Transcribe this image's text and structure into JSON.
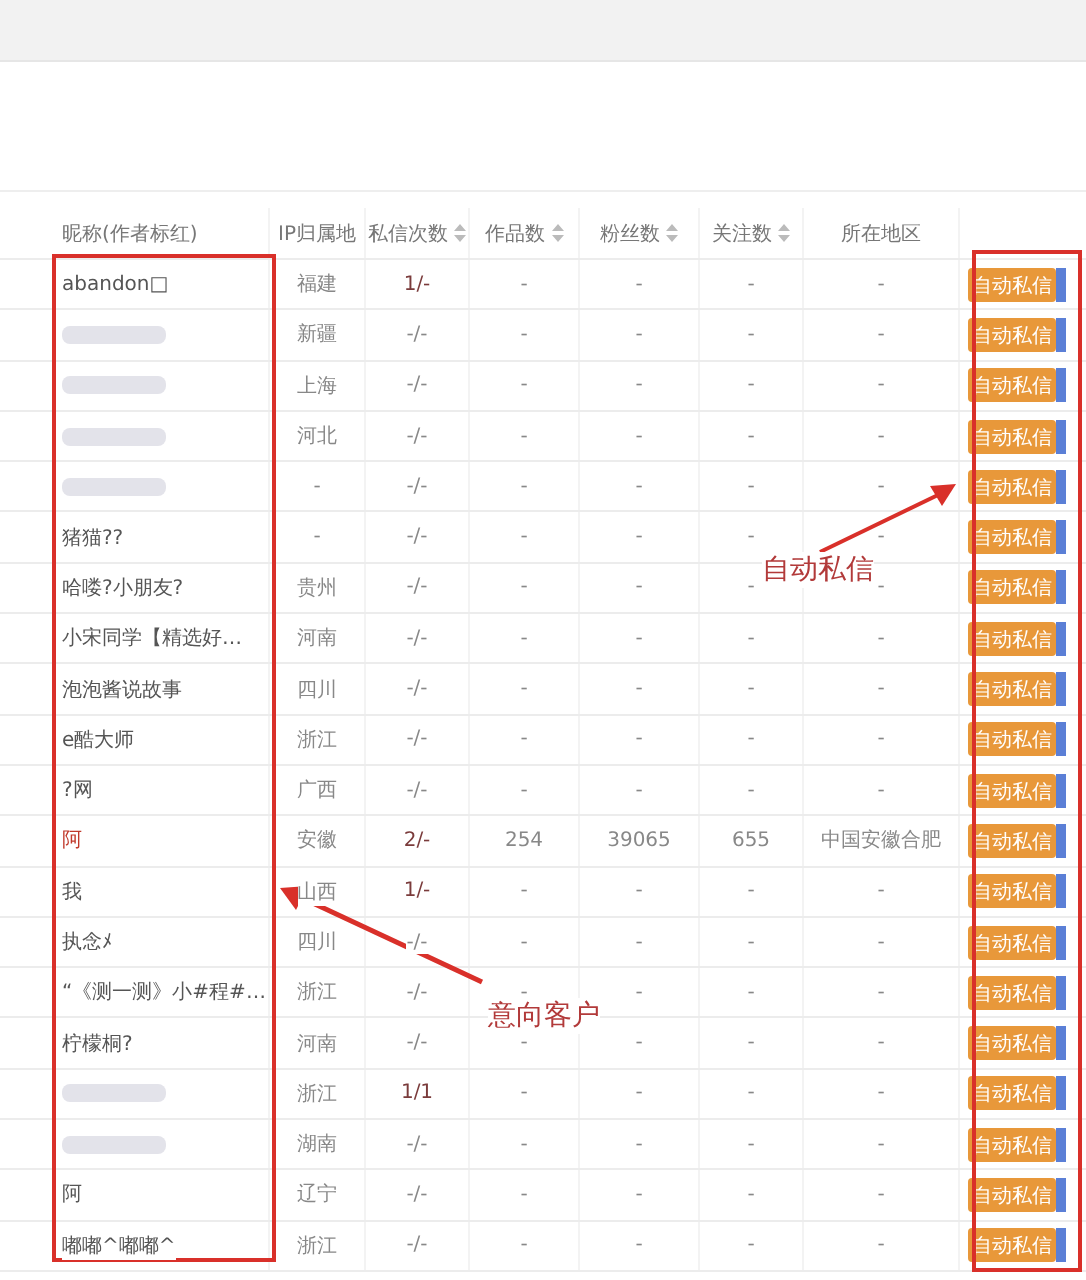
{
  "table": {
    "columns": [
      {
        "label": "昵称(作者标红)",
        "sortable": false
      },
      {
        "label": "IP归属地",
        "sortable": false
      },
      {
        "label": "私信次数",
        "sortable": true
      },
      {
        "label": "作品数",
        "sortable": true
      },
      {
        "label": "粉丝数",
        "sortable": true
      },
      {
        "label": "关注数",
        "sortable": true
      },
      {
        "label": "所在地区",
        "sortable": false
      }
    ],
    "rows": [
      {
        "name": "abandon□",
        "author": false,
        "ip": "福建",
        "messages": "1/-",
        "works": "-",
        "fans": "-",
        "follows": "-",
        "region": "-",
        "action": "自动私信"
      },
      {
        "author": false,
        "ip": "新疆",
        "messages": "-/-",
        "works": "-",
        "fans": "-",
        "follows": "-",
        "region": "-",
        "action": "自动私信"
      },
      {
        "author": false,
        "ip": "上海",
        "messages": "-/-",
        "works": "-",
        "fans": "-",
        "follows": "-",
        "region": "-",
        "action": "自动私信"
      },
      {
        "author": false,
        "ip": "河北",
        "messages": "-/-",
        "works": "-",
        "fans": "-",
        "follows": "-",
        "region": "-",
        "action": "自动私信"
      },
      {
        "author": false,
        "ip": "-",
        "messages": "-/-",
        "works": "-",
        "fans": "-",
        "follows": "-",
        "region": "-",
        "action": "自动私信"
      },
      {
        "name": "猪猫??",
        "author": false,
        "ip": "-",
        "messages": "-/-",
        "works": "-",
        "fans": "-",
        "follows": "-",
        "region": "-",
        "action": "自动私信"
      },
      {
        "name": "哈喽?小朋友?",
        "author": false,
        "ip": "贵州",
        "messages": "-/-",
        "works": "-",
        "fans": "-",
        "follows": "-",
        "region": "-",
        "action": "自动私信"
      },
      {
        "name": "小宋同学【精选好…",
        "author": false,
        "ip": "河南",
        "messages": "-/-",
        "works": "-",
        "fans": "-",
        "follows": "-",
        "region": "-",
        "action": "自动私信"
      },
      {
        "name": "泡泡酱说故事",
        "author": false,
        "ip": "四川",
        "messages": "-/-",
        "works": "-",
        "fans": "-",
        "follows": "-",
        "region": "-",
        "action": "自动私信"
      },
      {
        "name": "e酷大师",
        "author": false,
        "ip": "浙江",
        "messages": "-/-",
        "works": "-",
        "fans": "-",
        "follows": "-",
        "region": "-",
        "action": "自动私信"
      },
      {
        "name": "?网",
        "author": false,
        "ip": "广西",
        "messages": "-/-",
        "works": "-",
        "fans": "-",
        "follows": "-",
        "region": "-",
        "action": "自动私信"
      },
      {
        "name": "阿",
        "author": true,
        "ip": "安徽",
        "messages": "2/-",
        "works": "254",
        "fans": "39065",
        "follows": "655",
        "region": "中国安徽合肥",
        "action": "自动私信"
      },
      {
        "name": "我",
        "author": false,
        "ip": "山西",
        "messages": "1/-",
        "works": "-",
        "fans": "-",
        "follows": "-",
        "region": "-",
        "action": "自动私信"
      },
      {
        "name": "执念ﾒ",
        "author": false,
        "ip": "四川",
        "messages": "-/-",
        "works": "-",
        "fans": "-",
        "follows": "-",
        "region": "-",
        "action": "自动私信"
      },
      {
        "name": "“《测一测》小#程#…",
        "author": false,
        "ip": "浙江",
        "messages": "-/-",
        "works": "-",
        "fans": "-",
        "follows": "-",
        "region": "-",
        "action": "自动私信"
      },
      {
        "name": "柠檬桐?",
        "author": false,
        "ip": "河南",
        "messages": "-/-",
        "works": "-",
        "fans": "-",
        "follows": "-",
        "region": "-",
        "action": "自动私信"
      },
      {
        "author": false,
        "ip": "浙江",
        "messages": "1/1",
        "works": "-",
        "fans": "-",
        "follows": "-",
        "region": "-",
        "action": "自动私信"
      },
      {
        "author": false,
        "ip": "湖南",
        "messages": "-/-",
        "works": "-",
        "fans": "-",
        "follows": "-",
        "region": "-",
        "action": "自动私信"
      },
      {
        "name": "阿",
        "author": false,
        "ip": "辽宁",
        "messages": "-/-",
        "works": "-",
        "fans": "-",
        "follows": "-",
        "region": "-",
        "action": "自动私信"
      },
      {
        "name": "嘟嘟^嘟嘟^",
        "author": false,
        "ip": "浙江",
        "messages": "-/-",
        "works": "-",
        "fans": "-",
        "follows": "-",
        "region": "-",
        "action": "自动私信"
      }
    ]
  },
  "annotations": [
    {
      "kind": "actions",
      "label": "自动私信"
    },
    {
      "kind": "names",
      "label": "意向客户"
    }
  ]
}
